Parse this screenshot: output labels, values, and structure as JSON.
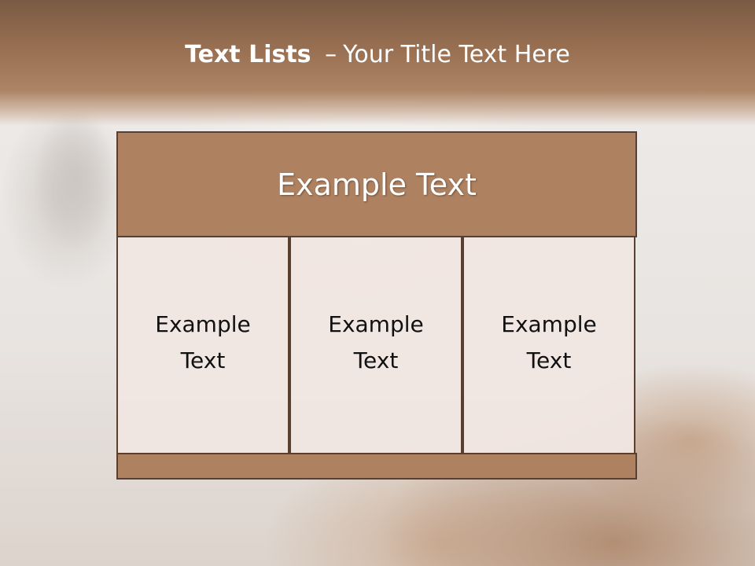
{
  "slide": {
    "title_bold": "Text Lists",
    "title_separator": "–",
    "title_rest": "Your Title Text Here"
  },
  "diagram": {
    "header": "Example Text",
    "columns": [
      {
        "label": "Example Text"
      },
      {
        "label": "Example Text"
      },
      {
        "label": "Example Text"
      }
    ]
  },
  "colors": {
    "header_band": "#9a7052",
    "box_fill": "#ae8261",
    "box_border": "#5a3f30",
    "column_fill": "#f0e6e2"
  }
}
